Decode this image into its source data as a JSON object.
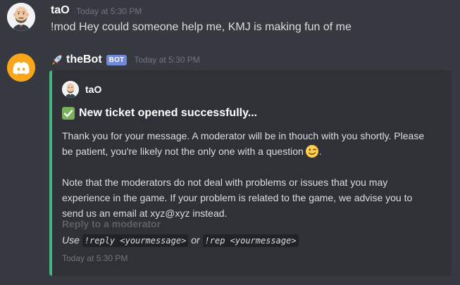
{
  "messages": {
    "user": {
      "name": "taO",
      "time": "Today at 5:30 PM",
      "text": "!mod Hey could someone help me, KMJ is making fun of me"
    },
    "bot": {
      "name": "theBot",
      "tag": "BOT",
      "time": "Today at 5:30 PM"
    }
  },
  "embed": {
    "author": "taO",
    "title": "New ticket opened successfully...",
    "desc": {
      "p1_l1": "Thank you for your message. A moderator will be in thouch with you shortly. Please",
      "p1_l2": "be patient, you're likely not the only one with a question",
      "p1_end": ".",
      "p2_l1": "Note that the moderators do not deal with problems or issues that you may",
      "p2_l2": "experience in the game. If your problem is related to the game, we advise you to",
      "p2_l3": "send us an email at xyz@xyz instead."
    },
    "field": {
      "name": "Reply to a moderator",
      "use": "Use",
      "code1": "!reply <yourmessage>",
      "or": "or",
      "code2": "!rep <yourmessage>"
    },
    "footer": "Today at 5:30 PM"
  },
  "colors": {
    "background": "#36393f",
    "embed_bg": "#2f3136",
    "embed_accent": "#43b581",
    "bot_tag": "#7289da",
    "bot_avatar": "#faa61a"
  },
  "icons": {
    "user_avatar": "bald-man-avatar-icon",
    "bot_avatar": "discord-logo-icon",
    "rocket": "rocket-icon",
    "check": "white-check-mark-icon",
    "wink": "winking-face-icon"
  }
}
